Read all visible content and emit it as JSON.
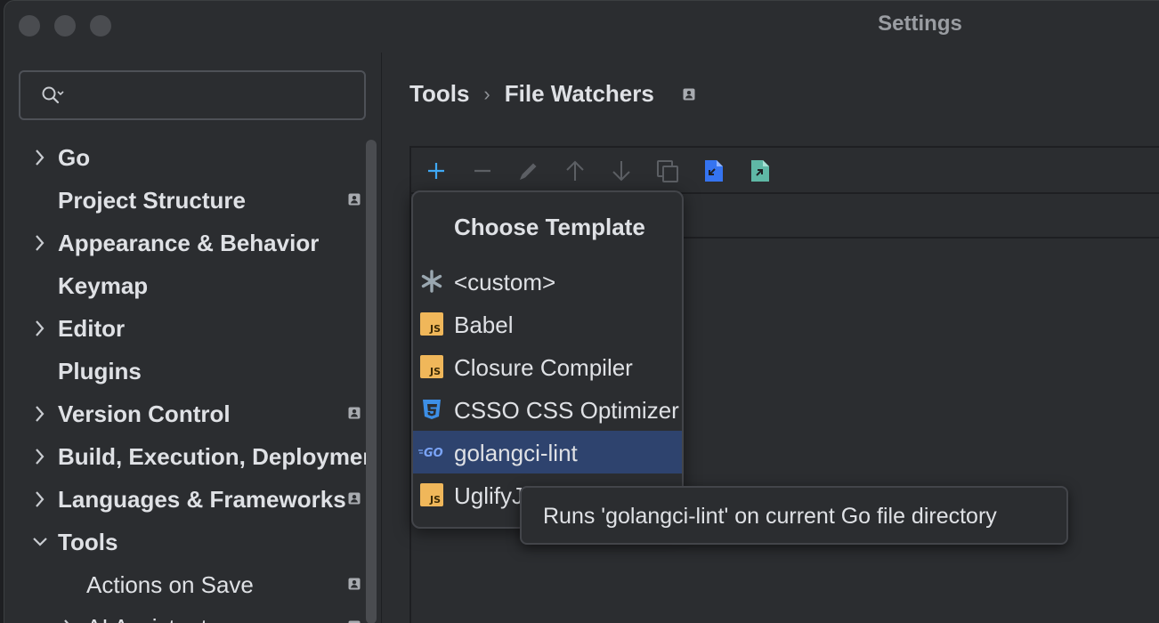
{
  "window": {
    "title": "Settings"
  },
  "search": {
    "placeholder": ""
  },
  "sidebar": {
    "items": [
      {
        "label": "Go",
        "expandable": true,
        "expanded": false,
        "project_icon": false,
        "child": false
      },
      {
        "label": "Project Structure",
        "expandable": false,
        "project_icon": true,
        "child": false
      },
      {
        "label": "Appearance & Behavior",
        "expandable": true,
        "expanded": false,
        "project_icon": false,
        "child": false
      },
      {
        "label": "Keymap",
        "expandable": false,
        "project_icon": false,
        "child": false
      },
      {
        "label": "Editor",
        "expandable": true,
        "expanded": false,
        "project_icon": false,
        "child": false
      },
      {
        "label": "Plugins",
        "expandable": false,
        "project_icon": false,
        "child": false
      },
      {
        "label": "Version Control",
        "expandable": true,
        "expanded": false,
        "project_icon": true,
        "child": false
      },
      {
        "label": "Build, Execution, Deployment",
        "expandable": true,
        "expanded": false,
        "project_icon": false,
        "child": false
      },
      {
        "label": "Languages & Frameworks",
        "expandable": true,
        "expanded": false,
        "project_icon": true,
        "child": false
      },
      {
        "label": "Tools",
        "expandable": true,
        "expanded": true,
        "project_icon": false,
        "child": false
      },
      {
        "label": "Actions on Save",
        "expandable": false,
        "project_icon": true,
        "child": true
      },
      {
        "label": "AI Assistant",
        "expandable": true,
        "expanded": false,
        "project_icon": true,
        "child": true
      }
    ]
  },
  "breadcrumb": {
    "parent": "Tools",
    "separator": "›",
    "current": "File Watchers"
  },
  "toolbar": {
    "buttons": [
      "add-icon",
      "remove-icon",
      "edit-icon",
      "move-up-icon",
      "move-down-icon",
      "copy-icon",
      "import-icon",
      "export-icon"
    ]
  },
  "template_popup": {
    "title": "Choose Template",
    "items": [
      {
        "name": "<custom>",
        "icon": "asterisk-icon"
      },
      {
        "name": "Babel",
        "icon": "js-icon"
      },
      {
        "name": "Closure Compiler",
        "icon": "js-icon"
      },
      {
        "name": "CSSO CSS Optimizer",
        "icon": "css3-icon"
      },
      {
        "name": "golangci-lint",
        "icon": "go-icon",
        "selected": true
      },
      {
        "name": "UglifyJS",
        "icon": "js-icon"
      }
    ]
  },
  "tooltip": {
    "text": "Runs 'golangci-lint' on current Go file directory"
  },
  "colors": {
    "accent": "#3574f0",
    "selection": "#2e436e",
    "js_badge": "#f0b75a",
    "go_blue": "#7aa4f7"
  }
}
